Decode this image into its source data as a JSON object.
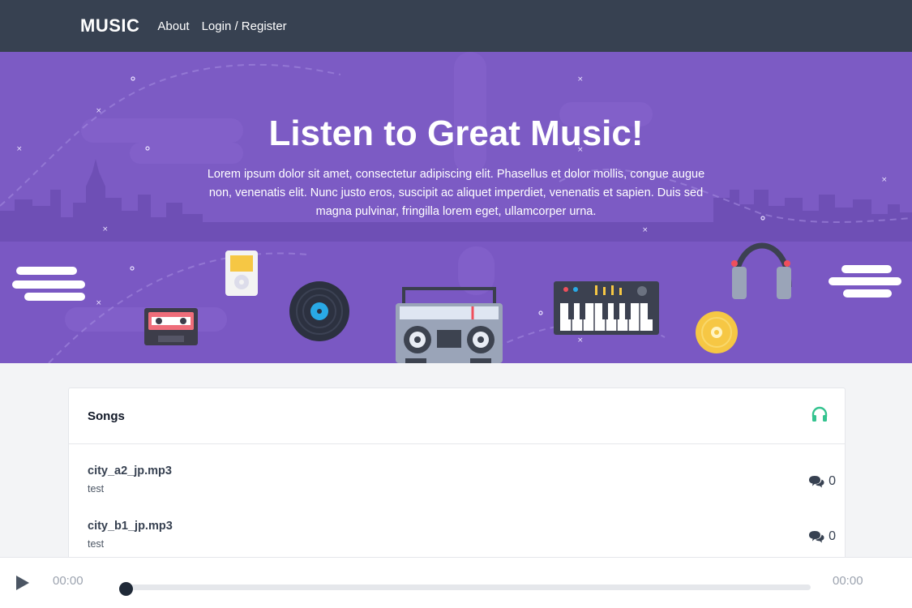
{
  "navbar": {
    "brand": "MUSIC",
    "links": [
      "About",
      "Login / Register"
    ]
  },
  "hero": {
    "title": "Listen to Great Music!",
    "text": "Lorem ipsum dolor sit amet, consectetur adipiscing elit. Phasellus et dolor mollis, congue augue non, venenatis elit. Nunc justo eros, suscipit ac aliquet imperdiet, venenatis et sapien. Duis sed magna pulvinar, fringilla lorem eget, ullamcorper urna."
  },
  "songs": {
    "title": "Songs",
    "header_icon": "headphones-icon",
    "items": [
      {
        "name": "city_a2_jp.mp3",
        "subtitle": "test",
        "comments": "0"
      },
      {
        "name": "city_b1_jp.mp3",
        "subtitle": "test",
        "comments": "0"
      }
    ]
  },
  "player": {
    "current_time": "00:00",
    "total_time": "00:00",
    "progress": 0
  },
  "colors": {
    "navbar": "#374151",
    "hero": "#7c5bc4",
    "accent_green": "#34c38f"
  }
}
